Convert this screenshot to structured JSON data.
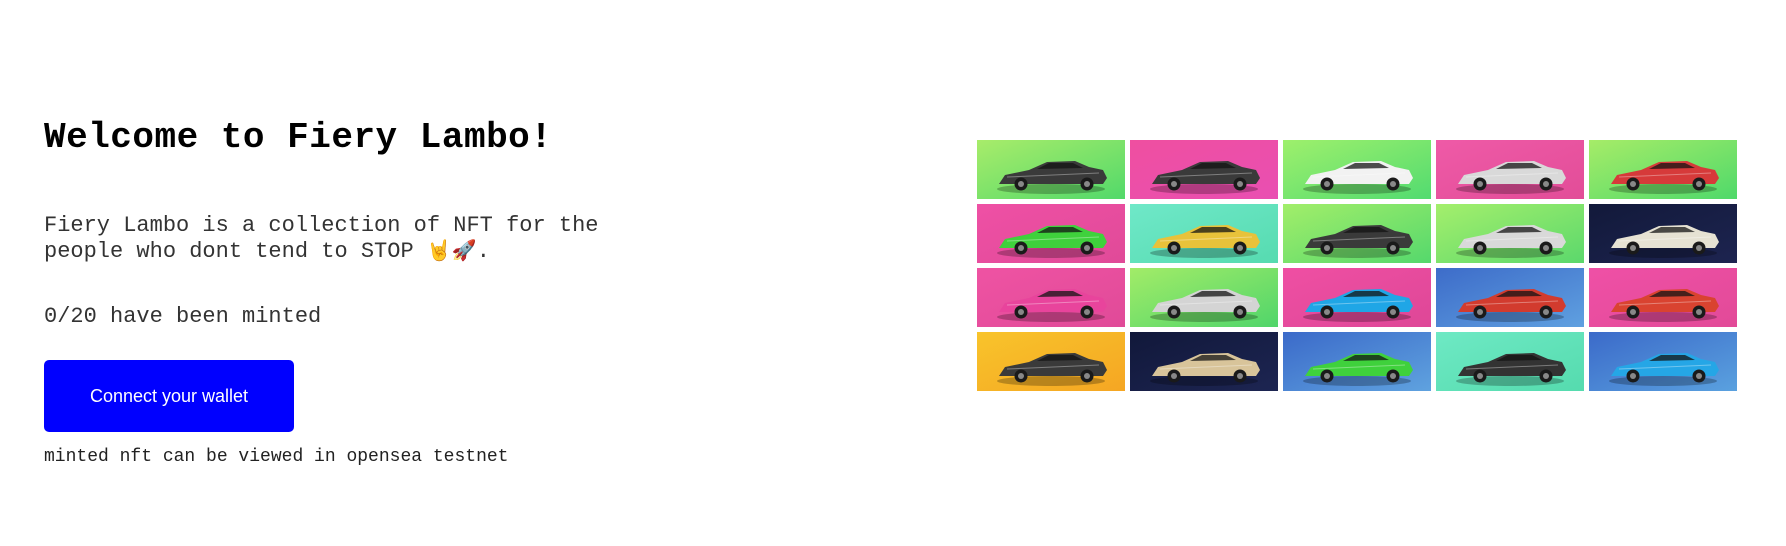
{
  "hero": {
    "title": "Welcome to Fiery Lambo!",
    "description": "Fiery Lambo is a collection of NFT for the people who dont tend to STOP",
    "description_emoji": "🤘🚀",
    "description_end": ".",
    "minted_status": "0/20 have been minted",
    "connect_button": "Connect your wallet",
    "note": "minted nft can be viewed in opensea testnet"
  },
  "gallery": {
    "tiles": [
      {
        "bg": [
          "#a8ec6a",
          "#52d96a"
        ],
        "car": "#3a3a3a"
      },
      {
        "bg": [
          "#ef4fa0",
          "#e94fb2"
        ],
        "car": "#3a3a3a"
      },
      {
        "bg": [
          "#9ef06c",
          "#52db70"
        ],
        "car": "#f2f2f2"
      },
      {
        "bg": [
          "#ef5aa7",
          "#e24d98"
        ],
        "car": "#d9d9d9"
      },
      {
        "bg": [
          "#a6ec68",
          "#4fd96a"
        ],
        "car": "#d63a3a"
      },
      {
        "bg": [
          "#ef50a5",
          "#e04a98"
        ],
        "car": "#3fd13c"
      },
      {
        "bg": [
          "#6fe8c8",
          "#56dbb0"
        ],
        "car": "#e8c23a"
      },
      {
        "bg": [
          "#a2ee6a",
          "#55d86c"
        ],
        "car": "#3a3a3a"
      },
      {
        "bg": [
          "#a4ef6c",
          "#5bd86c"
        ],
        "car": "#d9d9d9"
      },
      {
        "bg": [
          "#12193a",
          "#1d2450"
        ],
        "car": "#e6e2d3"
      },
      {
        "bg": [
          "#ef53a3",
          "#e04a98"
        ],
        "car": "#e8449c"
      },
      {
        "bg": [
          "#a2ec68",
          "#50d56a"
        ],
        "car": "#d4d4d4"
      },
      {
        "bg": [
          "#ef4fa3",
          "#de4797"
        ],
        "car": "#1fa6e6"
      },
      {
        "bg": [
          "#3d6cc9",
          "#5fa0e0"
        ],
        "car": "#d23b2e"
      },
      {
        "bg": [
          "#ef50a6",
          "#e24a98"
        ],
        "car": "#d94330"
      },
      {
        "bg": [
          "#f8c42b",
          "#f5a623"
        ],
        "car": "#3a3a3a"
      },
      {
        "bg": [
          "#11183a",
          "#1d2552"
        ],
        "car": "#d8c49a"
      },
      {
        "bg": [
          "#3b6ac9",
          "#5fa2df"
        ],
        "car": "#3fd13c"
      },
      {
        "bg": [
          "#6ee9c4",
          "#55dbae"
        ],
        "car": "#333333"
      },
      {
        "bg": [
          "#3b6ac9",
          "#5aa1df"
        ],
        "car": "#25a6e6"
      }
    ]
  }
}
